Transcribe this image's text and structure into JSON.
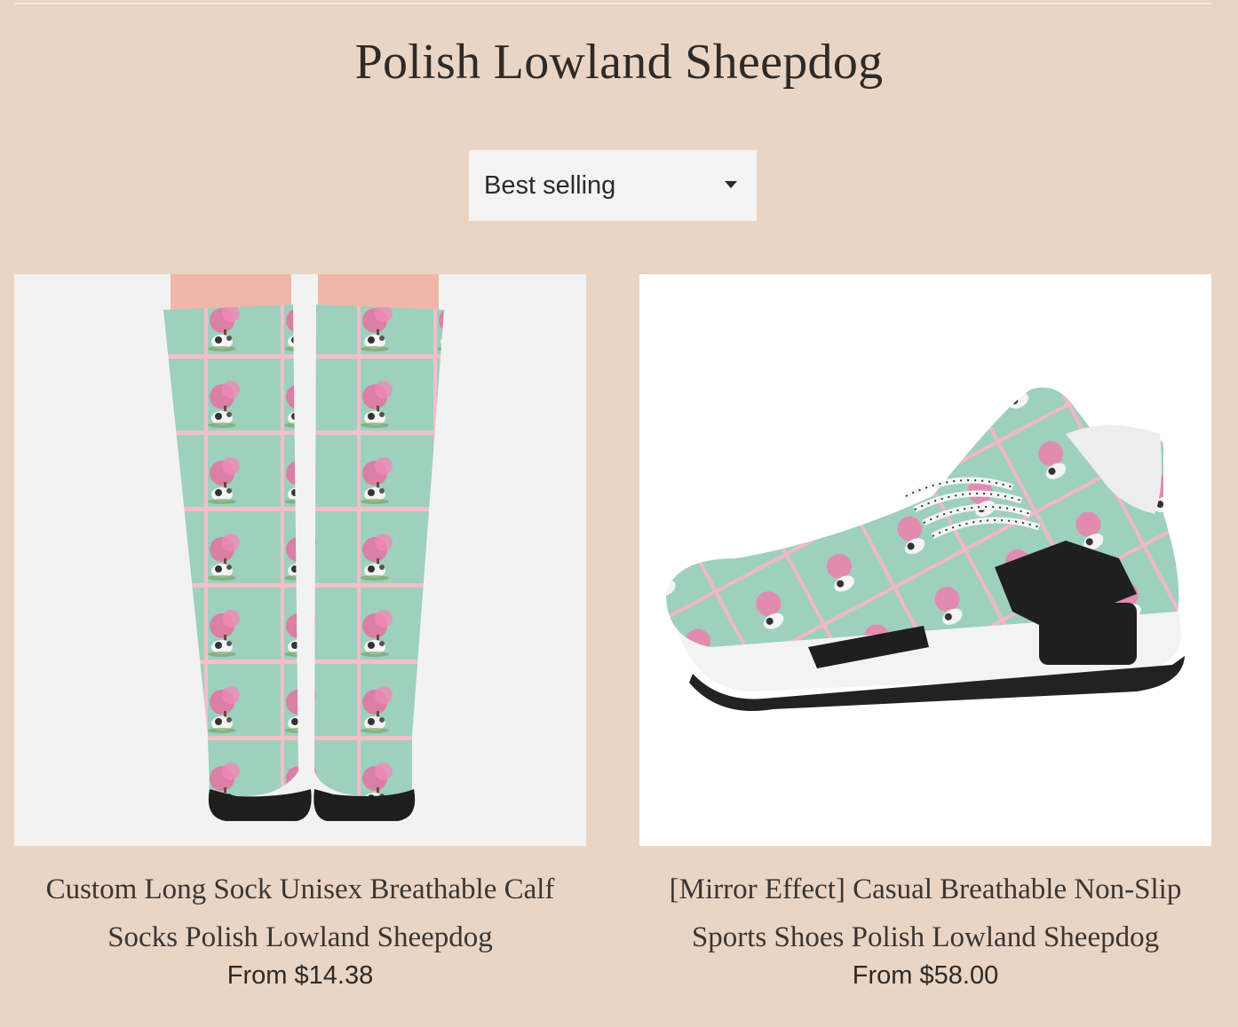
{
  "collection": {
    "title": "Polish Lowland Sheepdog"
  },
  "sort": {
    "selected": "Best selling"
  },
  "products": [
    {
      "name": "Custom Long Sock Unisex Breathable Calf Socks Polish Lowland Sheepdog",
      "price": "From $14.38",
      "image_icon": "socks-product-image"
    },
    {
      "name": "[Mirror Effect] Casual Breathable Non-Slip Sports Shoes Polish Lowland Sheepdog",
      "price": "From $58.00",
      "image_icon": "sneaker-product-image"
    }
  ],
  "colors": {
    "background": "#ead5c5",
    "pattern_mint": "#9ed0be",
    "pattern_pink": "#f2b8c6",
    "sock_toe": "#1e1e1e"
  }
}
